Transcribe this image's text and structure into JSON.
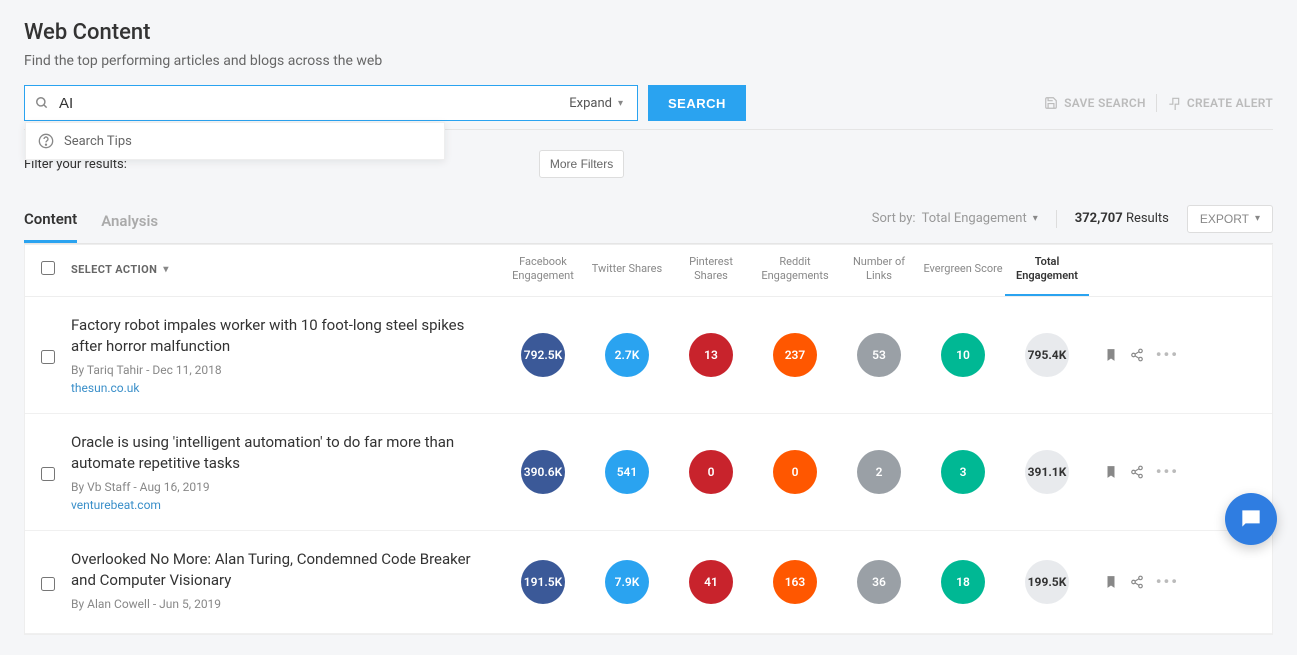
{
  "page": {
    "title": "Web Content",
    "subtitle": "Find the top performing articles and blogs across the web"
  },
  "search": {
    "value": "AI",
    "expand_label": "Expand",
    "search_button": "SEARCH",
    "tips_label": "Search Tips"
  },
  "actions": {
    "save_search": "SAVE SEARCH",
    "create_alert": "CREATE ALERT"
  },
  "filters": {
    "label": "Filter your results:",
    "more": "More Filters"
  },
  "tabs": {
    "content": "Content",
    "analysis": "Analysis"
  },
  "sort": {
    "label": "Sort by:",
    "value": "Total Engagement"
  },
  "results": {
    "count": "372,707",
    "suffix": "Results",
    "export": "EXPORT"
  },
  "columns": {
    "select_action": "SELECT ACTION",
    "facebook": "Facebook Engagement",
    "twitter": "Twitter Shares",
    "pinterest": "Pinterest Shares",
    "reddit": "Reddit Engagements",
    "links": "Number of Links",
    "evergreen": "Evergreen Score",
    "total": "Total Engagement"
  },
  "rows": [
    {
      "title": "Factory robot impales worker with 10 foot-long steel spikes after horror malfunction",
      "byline": "By Tariq Tahir - Dec 11, 2018",
      "domain": "thesun.co.uk",
      "fb": "792.5K",
      "tw": "2.7K",
      "pin": "13",
      "red": "237",
      "links": "53",
      "ever": "10",
      "total": "795.4K"
    },
    {
      "title": "Oracle is using 'intelligent automation' to do far more than automate repetitive tasks",
      "byline": "By Vb Staff - Aug 16, 2019",
      "domain": "venturebeat.com",
      "fb": "390.6K",
      "tw": "541",
      "pin": "0",
      "red": "0",
      "links": "2",
      "ever": "3",
      "total": "391.1K"
    },
    {
      "title": "Overlooked No More: Alan Turing, Condemned Code Breaker and Computer Visionary",
      "byline": "By Alan Cowell - Jun 5, 2019",
      "domain": "",
      "fb": "191.5K",
      "tw": "7.9K",
      "pin": "41",
      "red": "163",
      "links": "36",
      "ever": "18",
      "total": "199.5K"
    }
  ]
}
